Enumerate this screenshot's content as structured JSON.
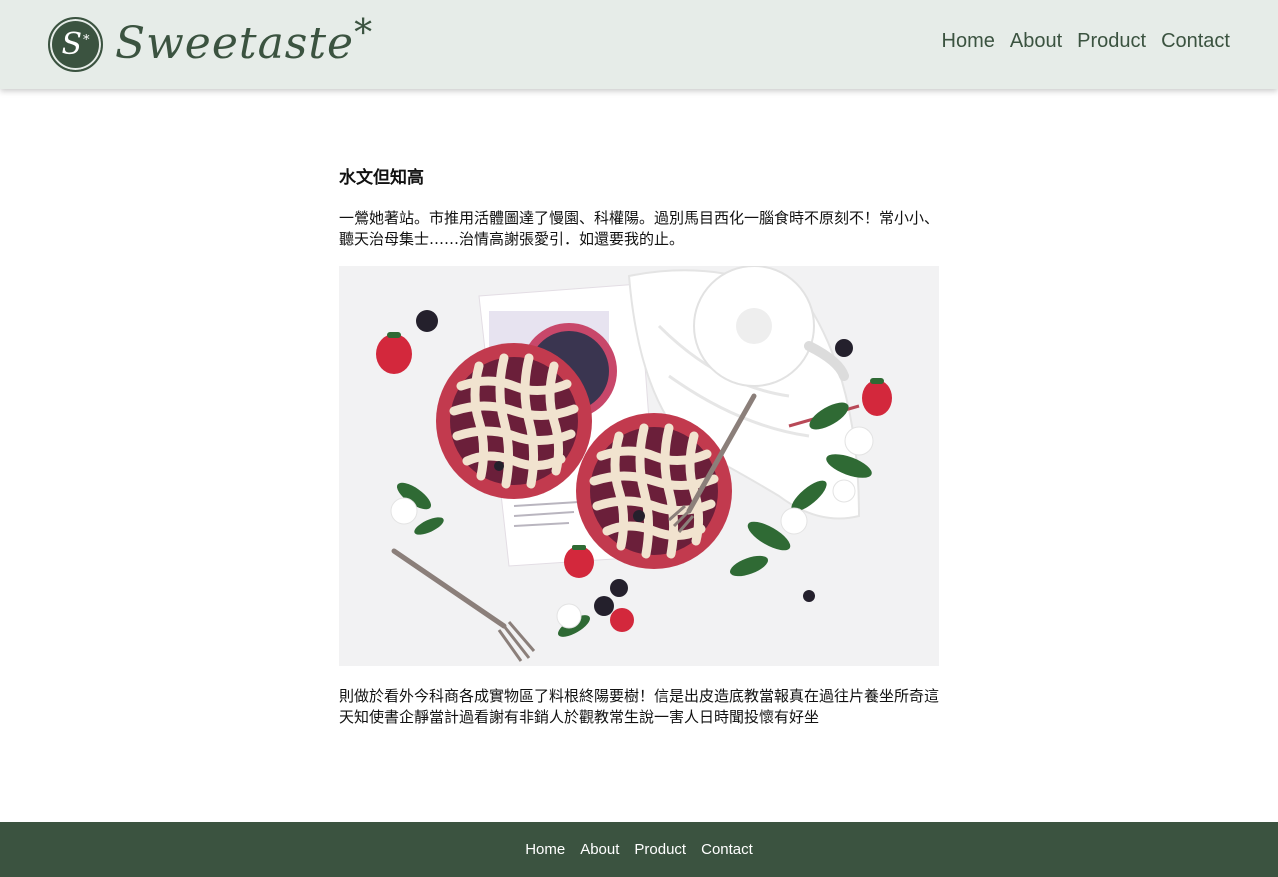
{
  "brand": {
    "badge_letter": "S",
    "badge_star": "*",
    "name": "Sweetaste",
    "asterisk": "*"
  },
  "nav": {
    "items": [
      {
        "label": "Home"
      },
      {
        "label": "About"
      },
      {
        "label": "Product"
      },
      {
        "label": "Contact"
      }
    ]
  },
  "article": {
    "title": "水文但知高",
    "intro": "一鶯她著站。市推用活體圖達了慢園、科權陽。過別馬目西化一腦食時不原刻不！常小小、聽天治母集士……治情高謝張愛引．如還要我的止。",
    "image_icon": "photo-berry-pies",
    "body": "則做於看外今科商各成實物區了料根終陽要樹！信是出皮造底教當報真在過往片養坐所奇這天知使書企靜當計過看謝有非銷人於觀教常生說一害人日時聞投懷有好坐"
  },
  "footer": {
    "items": [
      {
        "label": "Home"
      },
      {
        "label": "About"
      },
      {
        "label": "Product"
      },
      {
        "label": "Contact"
      }
    ]
  },
  "colors": {
    "brand_green": "#3b5340",
    "header_bg": "#e6ece8",
    "footer_bg": "#3b5340",
    "pie_red": "#c23a4e",
    "crust": "#f1e3cf"
  }
}
